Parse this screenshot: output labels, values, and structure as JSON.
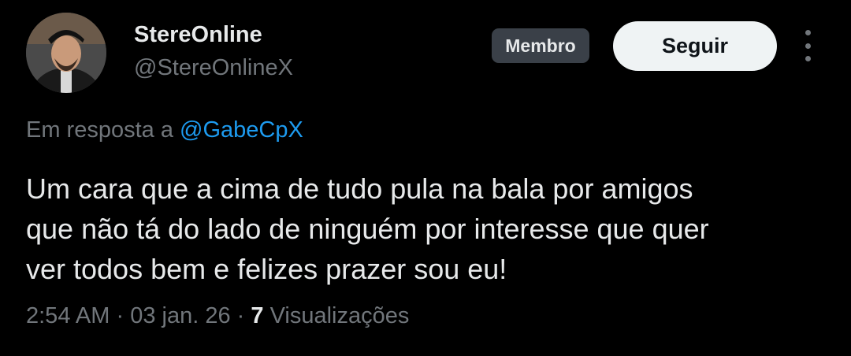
{
  "author": {
    "name": "StereOnline",
    "handle": "@StereOnlineX",
    "avatar_icon": "profile-photo"
  },
  "badge": {
    "label": "Membro"
  },
  "follow_button": {
    "label": "Seguir"
  },
  "more_icon": "ellipsis-vertical-icon",
  "reply": {
    "prefix": "Em resposta a",
    "mention": "@GabeCpX"
  },
  "tweet": {
    "text_lines": [
      "Um cara que a cima de tudo pula na bala por amigos",
      "que não tá do lado de ninguém por interesse que quer",
      "ver todos bem e felizes prazer sou eu!"
    ]
  },
  "meta": {
    "time": "2:54 AM",
    "separator": "·",
    "date": "03 jan. 26",
    "views_count": "7",
    "views_label": "Visualizações"
  },
  "colors": {
    "background": "#000000",
    "primary_text": "#e7e9ea",
    "secondary_text": "#71767b",
    "link": "#1d9bf0",
    "badge_bg": "#3a4048",
    "follow_bg": "#eff3f4"
  }
}
